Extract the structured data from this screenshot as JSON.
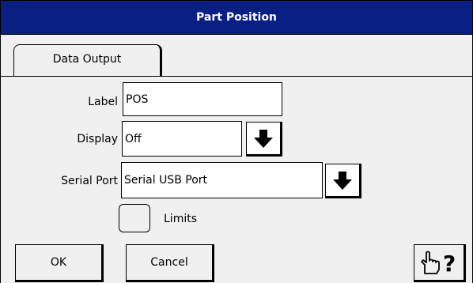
{
  "window": {
    "title": "Part Position"
  },
  "tabs": [
    {
      "label": "Data Output",
      "active": true
    }
  ],
  "form": {
    "label_caption": "Label",
    "label_value": "POS",
    "display_caption": "Display",
    "display_value": "Off",
    "serial_caption": "Serial Port",
    "serial_value": "Serial USB Port",
    "limits_caption": "Limits",
    "limits_checked": false
  },
  "buttons": {
    "ok_label": "OK",
    "cancel_label": "Cancel",
    "help_icon": "hand-question-icon"
  },
  "colors": {
    "titlebar": "#0a1f84",
    "panel": "#f0f0f0"
  }
}
